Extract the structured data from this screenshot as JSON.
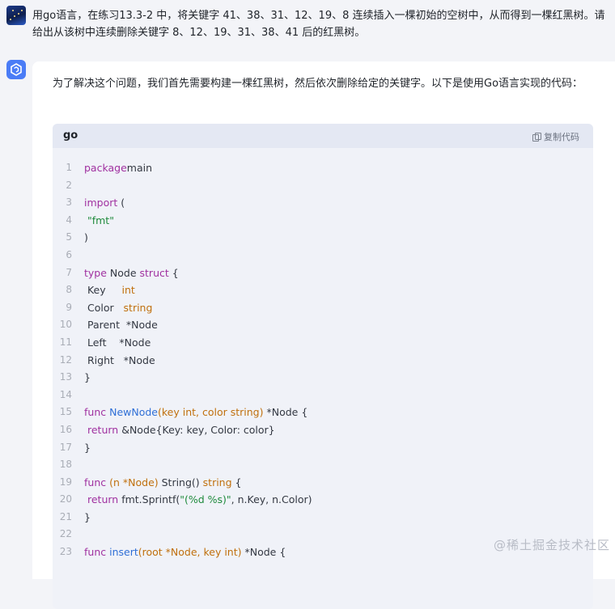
{
  "user_message": {
    "text": "用go语言，在练习13.3-2 中，将关键字 41、38、31、12、19、8 连续插入一棵初始的空树中，从而得到一棵红黑树。请给出从该树中连续删除关键字 8、12、19、31、38、41 后的红黑树。"
  },
  "assistant": {
    "intro": "为了解决这个问题，我们首先需要构建一棵红黑树，然后依次删除给定的关键字。以下是使用Go语言实现的代码：",
    "code_block": {
      "language": "go",
      "copy_label": "复制代码",
      "lines": [
        {
          "n": "1",
          "tokens": [
            [
              "kw",
              "package"
            ],
            [
              "",
              "main"
            ]
          ]
        },
        {
          "n": "2",
          "tokens": []
        },
        {
          "n": "3",
          "tokens": [
            [
              "kw",
              "import"
            ],
            [
              "",
              " ("
            ]
          ]
        },
        {
          "n": "4",
          "tokens": [
            [
              "",
              " "
            ],
            [
              "st",
              "\"fmt\""
            ]
          ]
        },
        {
          "n": "5",
          "tokens": [
            [
              "",
              ")"
            ]
          ]
        },
        {
          "n": "6",
          "tokens": []
        },
        {
          "n": "7",
          "tokens": [
            [
              "kw",
              "type"
            ],
            [
              "",
              " Node "
            ],
            [
              "kw",
              "struct"
            ],
            [
              "",
              " {"
            ]
          ]
        },
        {
          "n": "8",
          "tokens": [
            [
              "",
              "",
              " "
            ],
            [
              "",
              " Key     "
            ],
            [
              "ty",
              "int"
            ]
          ]
        },
        {
          "n": "9",
          "tokens": [
            [
              "",
              "",
              " "
            ],
            [
              "",
              " Color   "
            ],
            [
              "ty",
              "string"
            ]
          ]
        },
        {
          "n": "10",
          "tokens": [
            [
              "",
              "",
              " "
            ],
            [
              "",
              " Parent  *Node"
            ]
          ]
        },
        {
          "n": "11",
          "tokens": [
            [
              "",
              "",
              " "
            ],
            [
              "",
              " Left    *Node"
            ]
          ]
        },
        {
          "n": "12",
          "tokens": [
            [
              "",
              "",
              " "
            ],
            [
              "",
              " Right   *Node"
            ]
          ]
        },
        {
          "n": "13",
          "tokens": [
            [
              "",
              "}"
            ]
          ]
        },
        {
          "n": "14",
          "tokens": []
        },
        {
          "n": "15",
          "tokens": [
            [
              "kw",
              "func"
            ],
            [
              "",
              " "
            ],
            [
              "fn",
              "NewNode"
            ],
            [
              "ty",
              "(key int, color string)"
            ],
            [
              "",
              " *Node {"
            ]
          ]
        },
        {
          "n": "16",
          "tokens": [
            [
              "",
              " "
            ],
            [
              "kw",
              "return"
            ],
            [
              "",
              " &Node{Key: key, Color: color}"
            ]
          ]
        },
        {
          "n": "17",
          "tokens": [
            [
              "",
              "}"
            ]
          ]
        },
        {
          "n": "18",
          "tokens": []
        },
        {
          "n": "19",
          "tokens": [
            [
              "kw",
              "func"
            ],
            [
              "",
              " "
            ],
            [
              "ty",
              "(n *Node)"
            ],
            [
              "",
              " String() "
            ],
            [
              "ty",
              "string"
            ],
            [
              "",
              " {"
            ]
          ]
        },
        {
          "n": "20",
          "tokens": [
            [
              "",
              " "
            ],
            [
              "kw",
              "return"
            ],
            [
              "",
              " fmt.Sprintf("
            ],
            [
              "st",
              "\"(%d %s)\""
            ],
            [
              "",
              ", n.Key, n.Color)"
            ]
          ]
        },
        {
          "n": "21",
          "tokens": [
            [
              "",
              "}"
            ]
          ]
        },
        {
          "n": "22",
          "tokens": []
        },
        {
          "n": "23",
          "tokens": [
            [
              "kw",
              "func"
            ],
            [
              "",
              " "
            ],
            [
              "fn",
              "insert"
            ],
            [
              "ty",
              "(root *Node, key int)"
            ],
            [
              "",
              " *Node {"
            ]
          ]
        }
      ]
    }
  },
  "watermark": "@稀土掘金技术社区"
}
